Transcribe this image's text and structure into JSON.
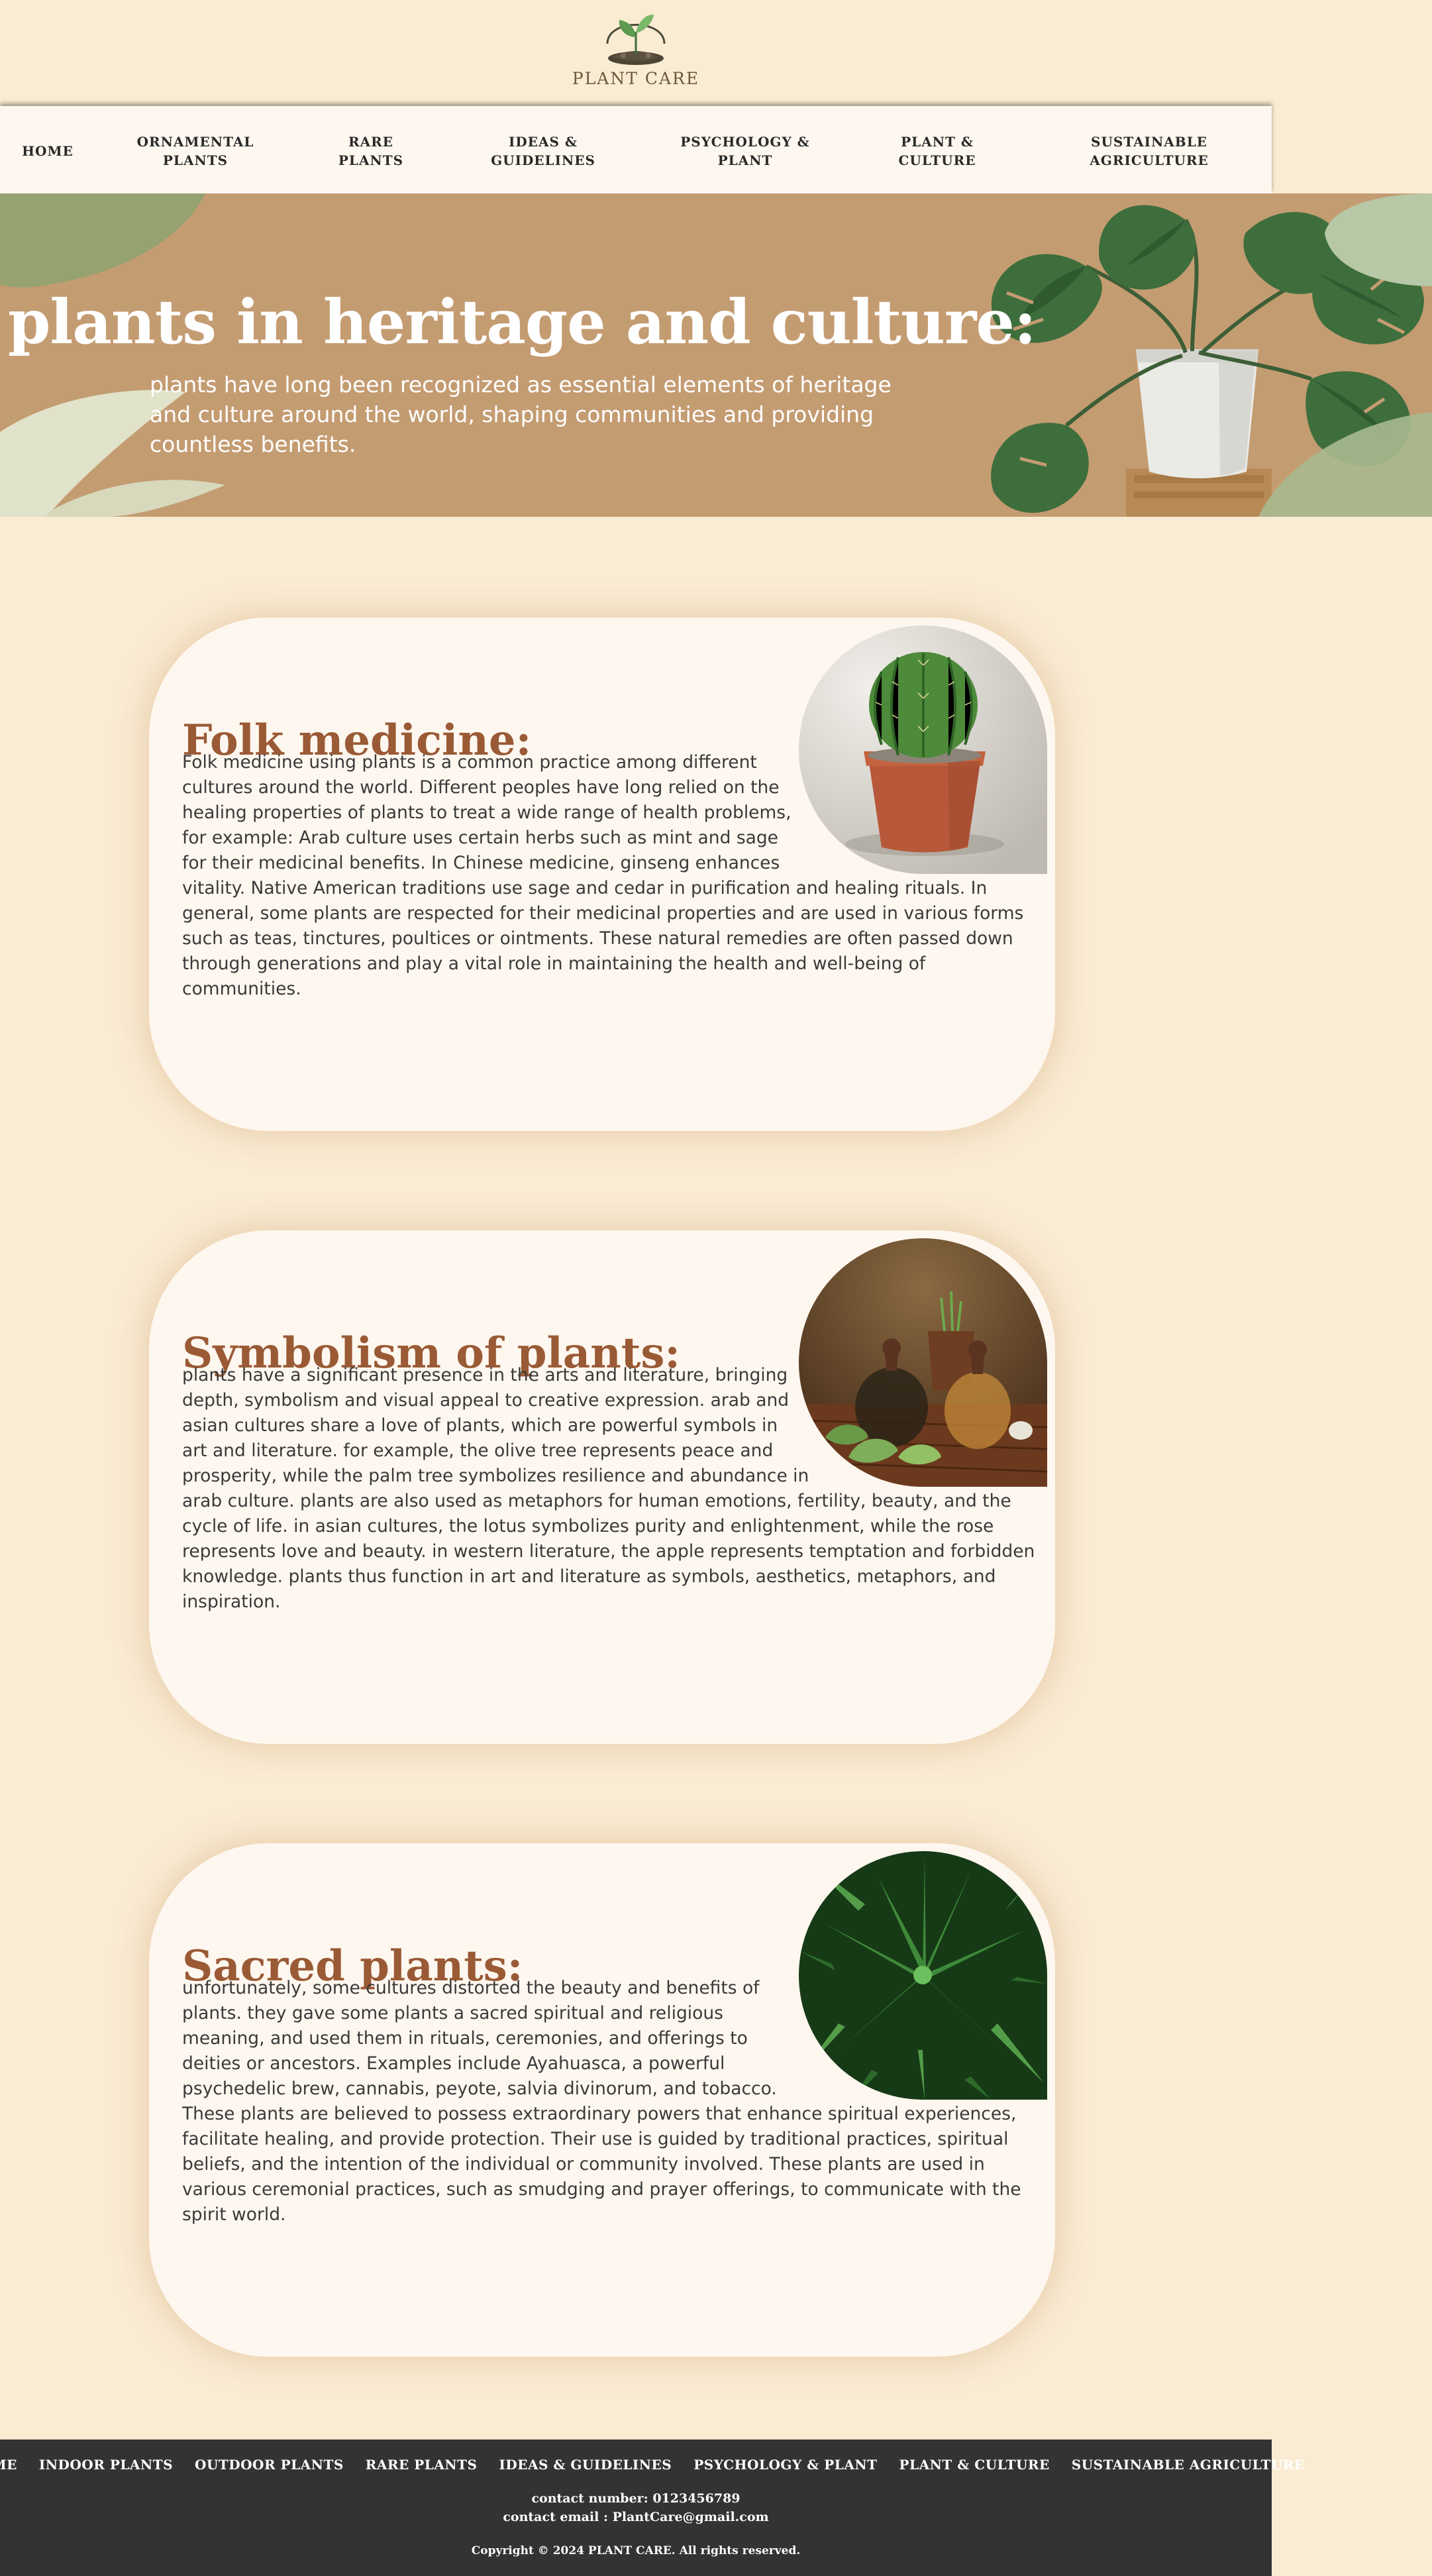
{
  "brand": {
    "name": "PLANT CARE",
    "logo_icon": "plant-sprout-logo"
  },
  "nav": {
    "items": [
      {
        "label": "HOME"
      },
      {
        "label": "ORNAMENTAL\nPLANTS"
      },
      {
        "label": "RARE\nPLANTS"
      },
      {
        "label": "IDEAS &\nGUIDELINES"
      },
      {
        "label": "PSYCHOLOGY &\nPLANT"
      },
      {
        "label": "PLANT &\nCULTURE"
      },
      {
        "label": "SUSTAINABLE\nAGRICULTURE"
      }
    ]
  },
  "hero": {
    "title": "plants in heritage and culture:",
    "subtitle": "plants have long been recognized as essential elements of heritage and culture around the world, shaping communities and providing countless benefits."
  },
  "sections": [
    {
      "title": "Folk medicine:",
      "image": "cactus-in-pot",
      "text": "Folk medicine using plants is a common practice among different cultures around the world. Different peoples have long relied on the healing properties of plants to treat a wide range of health problems, for example: Arab culture uses certain herbs such as mint and sage for their medicinal benefits. In Chinese medicine, ginseng enhances vitality. Native American traditions use sage and cedar in purification and healing rituals. In general, some plants are respected for their medicinal properties and are used in various forms such as teas, tinctures, poultices or ointments. These natural remedies are often passed down through generations and play a vital role in maintaining the health and well-being of communities."
    },
    {
      "title": "Symbolism of plants:",
      "image": "olive-oil-bottles",
      "text": "plants have a significant presence in the arts and literature, bringing depth, symbolism and visual appeal to creative expression. arab and asian cultures share a love of plants, which are powerful symbols in art and literature. for example, the olive tree represents peace and prosperity, while the palm tree symbolizes resilience and abundance in arab culture. plants are also used as metaphors for human emotions, fertility, beauty, and the cycle of life. in asian cultures, the lotus symbolizes purity and enlightenment, while the rose represents love and beauty. in western literature, the apple represents temptation and forbidden knowledge. plants thus function in art and literature as symbols, aesthetics, metaphors, and inspiration."
    },
    {
      "title": "Sacred plants:",
      "image": "cannabis-leaves",
      "text": "unfortunately, some cultures distorted the beauty and benefits of plants. they gave some plants a sacred spiritual and religious meaning, and used them in rituals, ceremonies, and offerings to deities or ancestors. Examples include Ayahuasca, a powerful psychedelic brew, cannabis, peyote, salvia divinorum, and tobacco. These plants are believed to possess extraordinary powers that enhance spiritual experiences, facilitate healing, and provide protection. Their use is guided by traditional practices, spiritual beliefs, and the intention of the individual or community involved. These plants are used in various ceremonial practices, such as smudging and prayer offerings, to communicate with the spirit world."
    }
  ],
  "footer": {
    "links": [
      {
        "label": "HOME"
      },
      {
        "label": "INDOOR PLANTS"
      },
      {
        "label": "OUTDOOR PLANTS"
      },
      {
        "label": "RARE PLANTS"
      },
      {
        "label": "IDEAS & GUIDELINES"
      },
      {
        "label": "PSYCHOLOGY & PLANT"
      },
      {
        "label": "PLANT & CULTURE"
      },
      {
        "label": "SUSTAINABLE AGRICULTURE"
      }
    ],
    "contact_number": "contact number: 0123456789",
    "contact_email": "contact email : PlantCare@gmail.com",
    "copyright": "Copyright © 2024 PLANT CARE. All rights reserved."
  },
  "colors": {
    "page_bg": "#faebd3",
    "nav_bg": "#fef7ef",
    "hero_bg": "#c49c72",
    "card_bg": "#fef7ef",
    "heading": "#9a5a35",
    "footer_bg": "#333333"
  }
}
